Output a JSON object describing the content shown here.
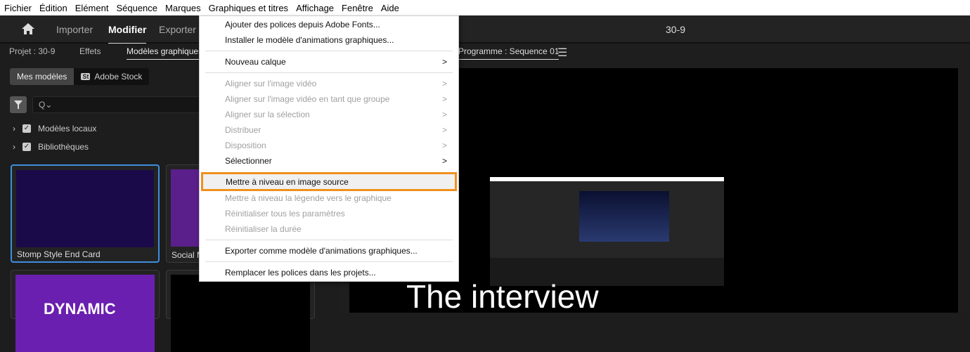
{
  "menubar": [
    "Fichier",
    "Édition",
    "Elément",
    "Séquence",
    "Marques",
    "Graphiques et titres",
    "Affichage",
    "Fenêtre",
    "Aide"
  ],
  "header": {
    "workspaces": [
      "Importer",
      "Modifier",
      "Exporter"
    ],
    "title": "30-9"
  },
  "left_panel": {
    "tabs": [
      "Projet : 30-9",
      "Effets",
      "Modèles graphiques"
    ],
    "seg": [
      "Mes modèles",
      "Adobe Stock"
    ],
    "stock_badge": "St",
    "search_placeholder": "Q⌄",
    "tree": [
      "Modèles locaux",
      "Bibliothèques"
    ],
    "cards": [
      "Stomp Style End Card",
      "Social M"
    ],
    "card_thumb_text": "DYNAMIC"
  },
  "program": {
    "tab": "Programme : Sequence 01",
    "caption": "The interview"
  },
  "menu": {
    "items": [
      {
        "label": "Ajouter des polices depuis Adobe Fonts...",
        "disabled": false
      },
      {
        "label": "Installer le modèle d'animations graphiques...",
        "disabled": false
      },
      {
        "label": "Nouveau calque",
        "disabled": false,
        "sub": true
      },
      {
        "label": "Aligner sur l'image vidéo",
        "disabled": true,
        "sub": true
      },
      {
        "label": "Aligner sur l'image vidéo en tant que groupe",
        "disabled": true,
        "sub": true
      },
      {
        "label": "Aligner sur la sélection",
        "disabled": true,
        "sub": true
      },
      {
        "label": "Distribuer",
        "disabled": true,
        "sub": true
      },
      {
        "label": "Disposition",
        "disabled": true,
        "sub": true
      },
      {
        "label": "Sélectionner",
        "disabled": false,
        "sub": true
      },
      {
        "label": "Mettre à niveau en image source",
        "disabled": false,
        "highlighted": true
      },
      {
        "label": "Mettre à niveau la légende vers le graphique",
        "disabled": true
      },
      {
        "label": "Réinitialiser tous les paramètres",
        "disabled": true
      },
      {
        "label": "Réinitialiser la durée",
        "disabled": true
      },
      {
        "label": "Exporter comme modèle d'animations graphiques...",
        "disabled": false
      },
      {
        "label": "Remplacer les polices dans les projets...",
        "disabled": false
      }
    ],
    "arrow": ">"
  },
  "colors": {
    "highlight": "#f0901e",
    "selection": "#3e8edf"
  }
}
